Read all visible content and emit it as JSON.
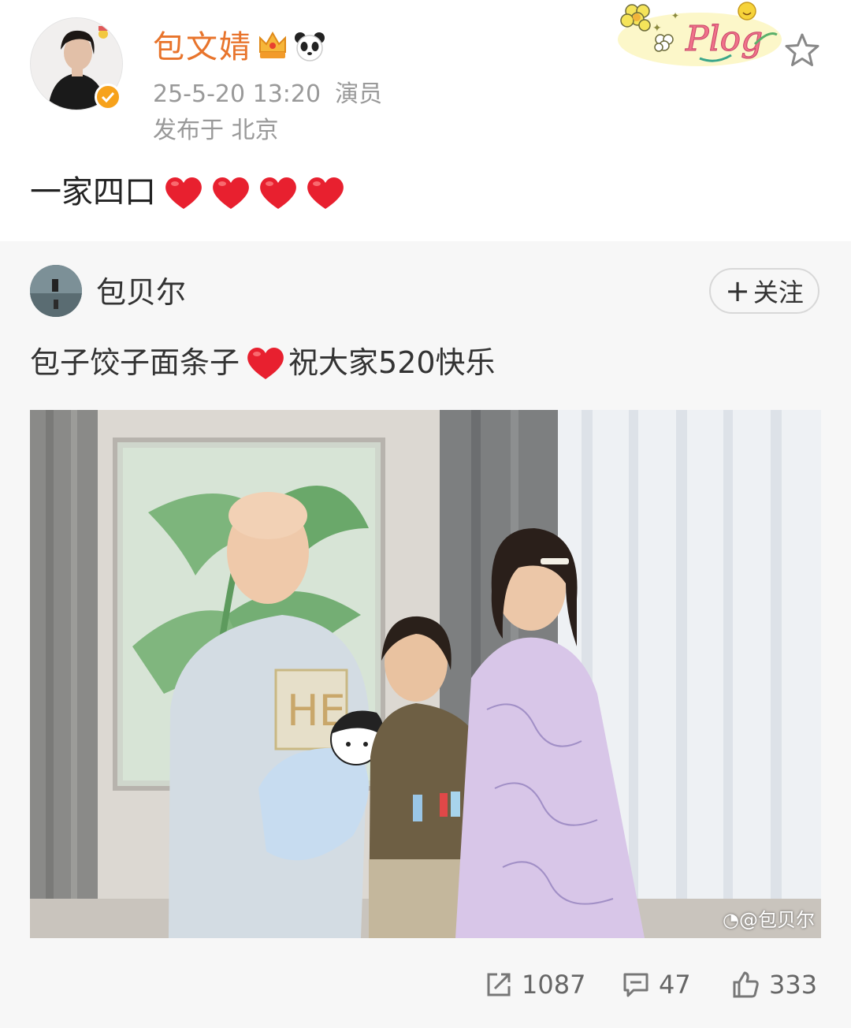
{
  "post": {
    "author": "包文婧",
    "timestamp": "25-5-20 13:20",
    "role": "演员",
    "location": "发布于 北京",
    "text": "一家四口"
  },
  "badges": {
    "crown_icon": "crown-icon",
    "panda_icon": "panda-icon",
    "plog_label": "Plog"
  },
  "repost": {
    "author": "包贝尔",
    "follow_label": "关注",
    "text_before": "包子饺子面条子",
    "text_after": "祝大家520快乐",
    "watermark": "@包贝尔"
  },
  "actions": {
    "share_count": "1087",
    "comment_count": "47",
    "like_count": "333"
  },
  "colors": {
    "username": "#e8742c",
    "verified": "#f7a21b",
    "heart": "#e8202f",
    "card_bg": "#f7f7f7"
  }
}
